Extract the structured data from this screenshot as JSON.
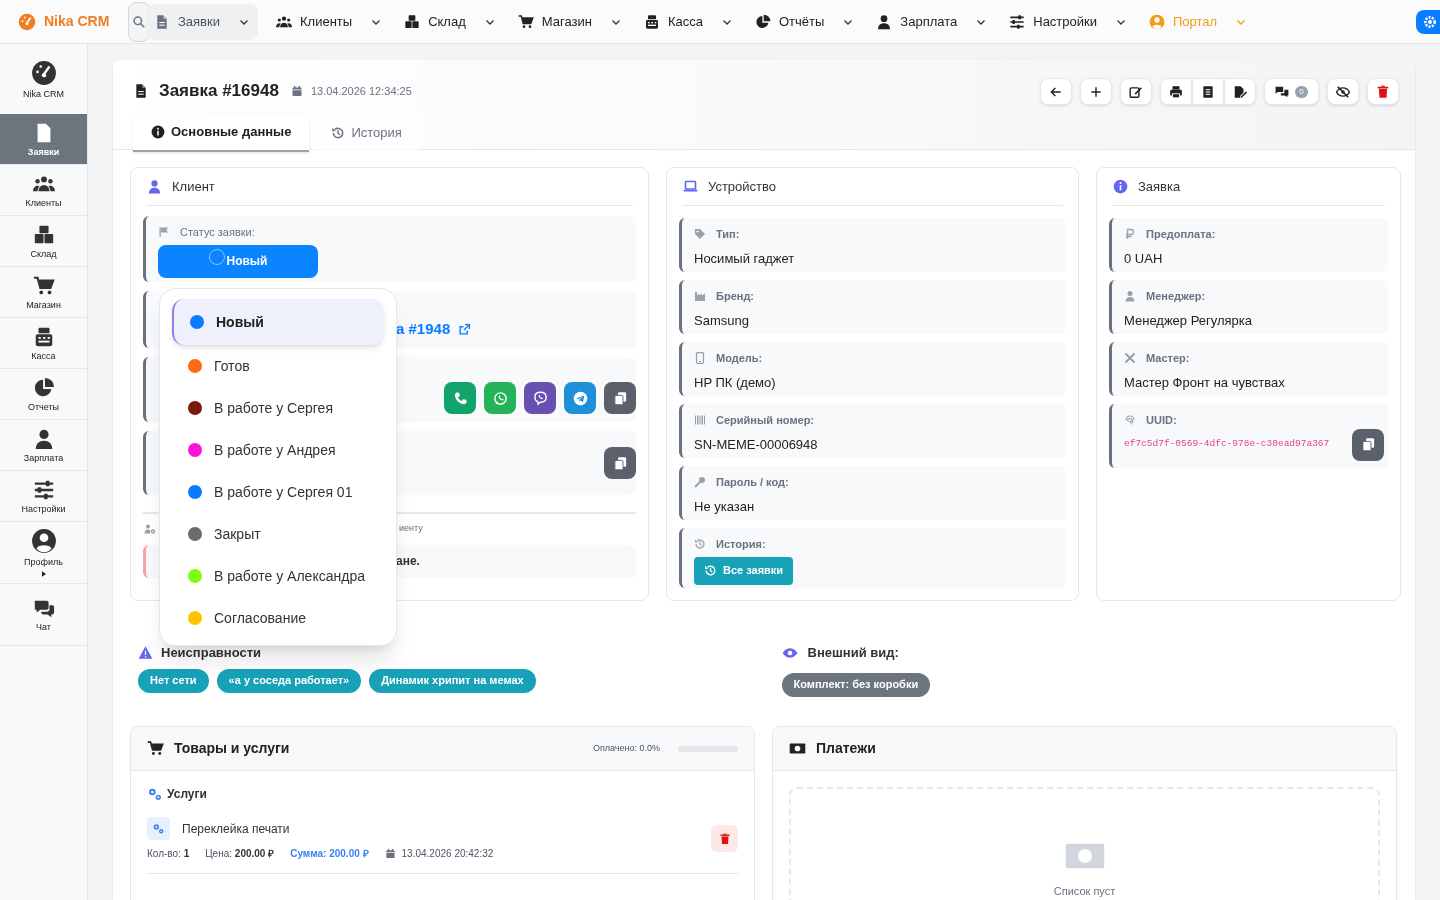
{
  "topbar": {
    "brand": "Nika CRM",
    "items": [
      {
        "label": "Заявки",
        "kind": "menu",
        "selected": true
      },
      {
        "label": "Клиенты",
        "kind": "menu",
        "selected": false
      },
      {
        "label": "Склад",
        "kind": "menu",
        "selected": false
      },
      {
        "label": "Магазин",
        "kind": "menu",
        "selected": false
      },
      {
        "label": "Касса",
        "kind": "menu",
        "selected": false
      },
      {
        "label": "Отчёты",
        "kind": "menu",
        "selected": false
      },
      {
        "label": "Зарплата",
        "kind": "menu",
        "selected": false
      },
      {
        "label": "Настройки",
        "kind": "menu",
        "selected": false
      },
      {
        "label": "Портал",
        "kind": "portal",
        "selected": false
      }
    ]
  },
  "sidebar": {
    "items": [
      {
        "label": "Nika CRM",
        "selected": false
      },
      {
        "label": "Заявки",
        "selected": true
      },
      {
        "label": "Клиенты",
        "selected": false
      },
      {
        "label": "Склад",
        "selected": false
      },
      {
        "label": "Магазин",
        "selected": false
      },
      {
        "label": "Касса",
        "selected": false
      },
      {
        "label": "Отчеты",
        "selected": false
      },
      {
        "label": "Зарплата",
        "selected": false
      },
      {
        "label": "Настройки",
        "selected": false
      },
      {
        "label": "Профиль",
        "selected": false
      },
      {
        "label": "Чат",
        "selected": false
      }
    ]
  },
  "header": {
    "title": "Заявка #16948",
    "date": "13.04.2026 12:34:25",
    "comment_count": "0",
    "tabs": [
      {
        "label": "Основные данные",
        "selected": true
      },
      {
        "label": "История",
        "selected": false
      }
    ]
  },
  "client": {
    "title": "Клиент",
    "status_label": "Статус заявки:",
    "status": "Новый",
    "link": "а #1948",
    "note": "иенту",
    "alert": "ане.",
    "dropdown": [
      {
        "label": "Новый",
        "color": "#0a7cff",
        "selected": true
      },
      {
        "label": "Готов",
        "color": "#ff6a13",
        "selected": false
      },
      {
        "label": "В работе у Сергея",
        "color": "#7a1a0c",
        "selected": false
      },
      {
        "label": "В работе у Андрея",
        "color": "#ff12d8",
        "selected": false
      },
      {
        "label": "В работе у Сергея 01",
        "color": "#0a7cff",
        "selected": false
      },
      {
        "label": "Закрыт",
        "color": "#6b6b6b",
        "selected": false
      },
      {
        "label": "В работе у Александра",
        "color": "#7cff12",
        "selected": false
      },
      {
        "label": "Согласование",
        "color": "#ffc400",
        "selected": false
      }
    ]
  },
  "device": {
    "title": "Устройство",
    "fields": [
      {
        "label": "Тип:",
        "value": "Носимый гаджет"
      },
      {
        "label": "Бренд:",
        "value": "Samsung"
      },
      {
        "label": "Модель:",
        "value": "HP ПК (демо)"
      },
      {
        "label": "Серийный номер:",
        "value": "SN-MEME-00006948"
      },
      {
        "label": "Пароль / код:",
        "value": "Не указан"
      }
    ],
    "history_label": "История:",
    "history_button": "Все заявки"
  },
  "request": {
    "title": "Заявка",
    "fields": [
      {
        "label": "Предоплата:",
        "value": "0 UAH"
      },
      {
        "label": "Менеджер:",
        "value": "Менеджер Регулярка"
      },
      {
        "label": "Мастер:",
        "value": "Мастер Фронт на чувствах"
      }
    ],
    "uuid_label": "UUID:",
    "uuid": "ef7c5d7f-0569-4dfc-978e-c30ead97a367"
  },
  "defects": {
    "title": "Неисправности",
    "tags": [
      "Нет сети",
      "«а у соседа работает»",
      "Динамик хрипит на мемах"
    ]
  },
  "appearance": {
    "title": "Внешний вид:",
    "tags": [
      "Комплект: без коробки"
    ]
  },
  "goods": {
    "title": "Товары и услуги",
    "paid": "Оплачено: 0.0%",
    "level": 0,
    "section": "Услуги",
    "items": [
      {
        "name": "Переклейка печати",
        "qty_label": "Кол-во:",
        "qty": "1",
        "price_label": "Цена:",
        "price": "200.00 ₽",
        "sum": "Сумма: 200.00 ₽",
        "date": "13.04.2026 20:42:32"
      }
    ]
  },
  "payments": {
    "title": "Платежи",
    "empty": "Список пуст"
  }
}
